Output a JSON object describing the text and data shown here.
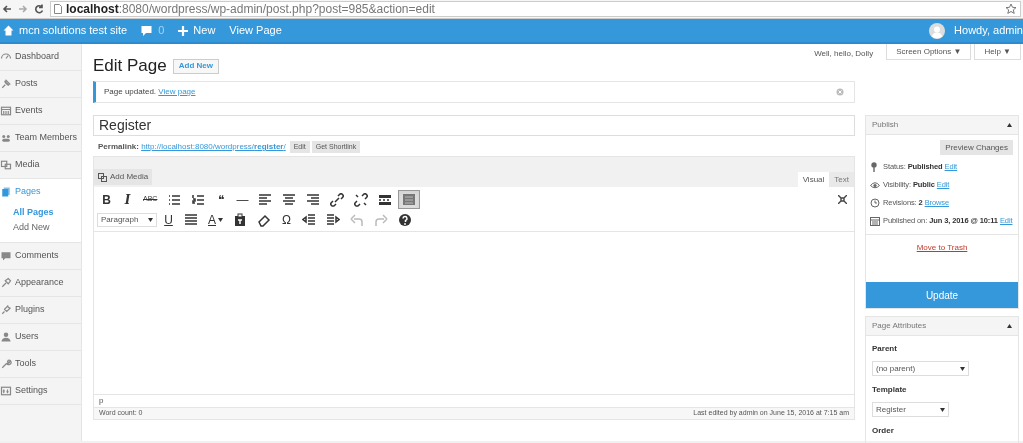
{
  "browser": {
    "url": "**localhost**:8080/wordpress/wp-admin/post.php?post=985&action=edit"
  },
  "admin_bar": {
    "site": "mcn solutions test site",
    "comments": "0",
    "new": "New",
    "view": "View Page",
    "howdy": "Howdy, admin"
  },
  "sidebar": {
    "items": [
      {
        "label": "Dashboard",
        "selected": false
      },
      {
        "label": "Posts",
        "selected": false
      },
      {
        "label": "Events",
        "selected": false
      },
      {
        "label": "Team Members",
        "selected": false
      },
      {
        "label": "Media",
        "selected": false
      },
      {
        "label": "Pages",
        "selected": true,
        "children": [
          {
            "label": "All Pages",
            "selected": true
          },
          {
            "label": "Add New",
            "selected": false
          }
        ]
      },
      {
        "label": "Comments",
        "selected": false
      },
      {
        "label": "Appearance",
        "selected": false
      },
      {
        "label": "Plugins",
        "selected": false
      },
      {
        "label": "Users",
        "selected": false
      },
      {
        "label": "Tools",
        "selected": false
      },
      {
        "label": "Settings",
        "selected": false
      }
    ]
  },
  "header": {
    "dolly": "Well, hello, Dolly",
    "screen_options": "Screen Options ▼",
    "help": "Help ▼",
    "title": "Edit Page",
    "add_new": "Add New"
  },
  "notice": {
    "text": "Page updated.",
    "link": "View page"
  },
  "post": {
    "title": "Register",
    "permalink_label": "Permalink:",
    "permalink_base": "http://localhost:8080/wordpress/",
    "permalink_slug": "register",
    "permalink_end": "/",
    "edit": "Edit",
    "shortlink": "Get Shortlink"
  },
  "editor": {
    "add_media": "Add Media",
    "tabs": [
      {
        "label": "Visual",
        "selected": true
      },
      {
        "label": "Text",
        "selected": false
      }
    ],
    "toolbar_1": [
      {
        "glyph": "B",
        "pressed": false
      },
      {
        "glyph": "I",
        "pressed": false
      },
      {
        "glyph": "ABC",
        "pressed": false
      },
      {
        "pressed": false
      },
      {
        "pressed": false
      },
      {
        "glyph": "❝",
        "pressed": false
      },
      {
        "glyph": "—",
        "pressed": false
      },
      {
        "pressed": false
      },
      {
        "pressed": false
      },
      {
        "pressed": false
      },
      {
        "pressed": false
      },
      {
        "pressed": false
      },
      {
        "pressed": false
      },
      {
        "pressed": true
      }
    ],
    "format": "Paragraph",
    "toolbar_2": [
      {
        "glyph": "U",
        "pressed": false
      },
      {
        "pressed": false
      },
      {
        "glyph": "A",
        "pressed": false
      },
      {
        "pressed": false
      },
      {
        "pressed": false
      },
      {
        "glyph": "Ω",
        "pressed": false
      },
      {
        "pressed": false
      },
      {
        "pressed": false
      },
      {
        "pressed": false,
        "disabled": true
      },
      {
        "pressed": false,
        "disabled": true
      },
      {
        "pressed": false
      }
    ],
    "path": "p",
    "word_count": "Word count: 0",
    "last_edited": "Last edited by admin on June 15, 2016 at 7:15 am"
  },
  "publish": {
    "title": "Publish",
    "preview": "Preview Changes",
    "rows": [
      {
        "label": "Status:",
        "value": "Published",
        "link": "Edit"
      },
      {
        "label": "Visibility:",
        "value": "Public",
        "link": "Edit"
      },
      {
        "label": "Revisions:",
        "value": "2",
        "link": "Browse"
      },
      {
        "label": "Published on:",
        "value": "Jun 3, 2016 @ 10:11",
        "link": "Edit"
      }
    ],
    "trash": "Move to Trash",
    "update": "Update"
  },
  "page_attributes": {
    "title": "Page Attributes",
    "parent_label": "Parent",
    "parent": "(no parent)",
    "template_label": "Template",
    "template": "Register",
    "order_label": "Order"
  }
}
